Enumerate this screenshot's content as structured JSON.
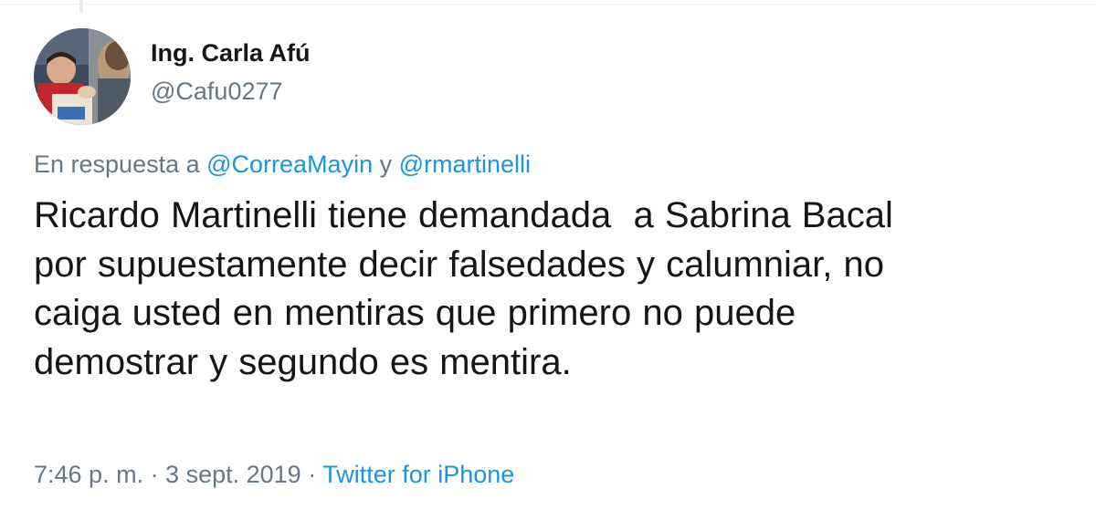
{
  "tweet": {
    "author": {
      "display_name": "Ing. Carla Afú",
      "handle": "@Cafu0277"
    },
    "reply_context": {
      "prefix": "En respuesta a ",
      "mention_1": "@CorreaMayin",
      "conjunction": " y ",
      "mention_2": "@rmartinelli"
    },
    "text": "Ricardo Martinelli tiene demandada  a Sabrina Bacal\npor supuestamente decir falsedades y calumniar, no\ncaiga usted en mentiras que primero no puede\ndemostrar y segundo es mentira.",
    "meta": {
      "timestamp": "7:46 p. m. · 3 sept. 2019",
      "separator": " · ",
      "source": "Twitter for iPhone"
    }
  },
  "colors": {
    "primary_text": "#14171a",
    "secondary_text": "#657786",
    "link": "#1b95e0",
    "background": "#ffffff"
  }
}
